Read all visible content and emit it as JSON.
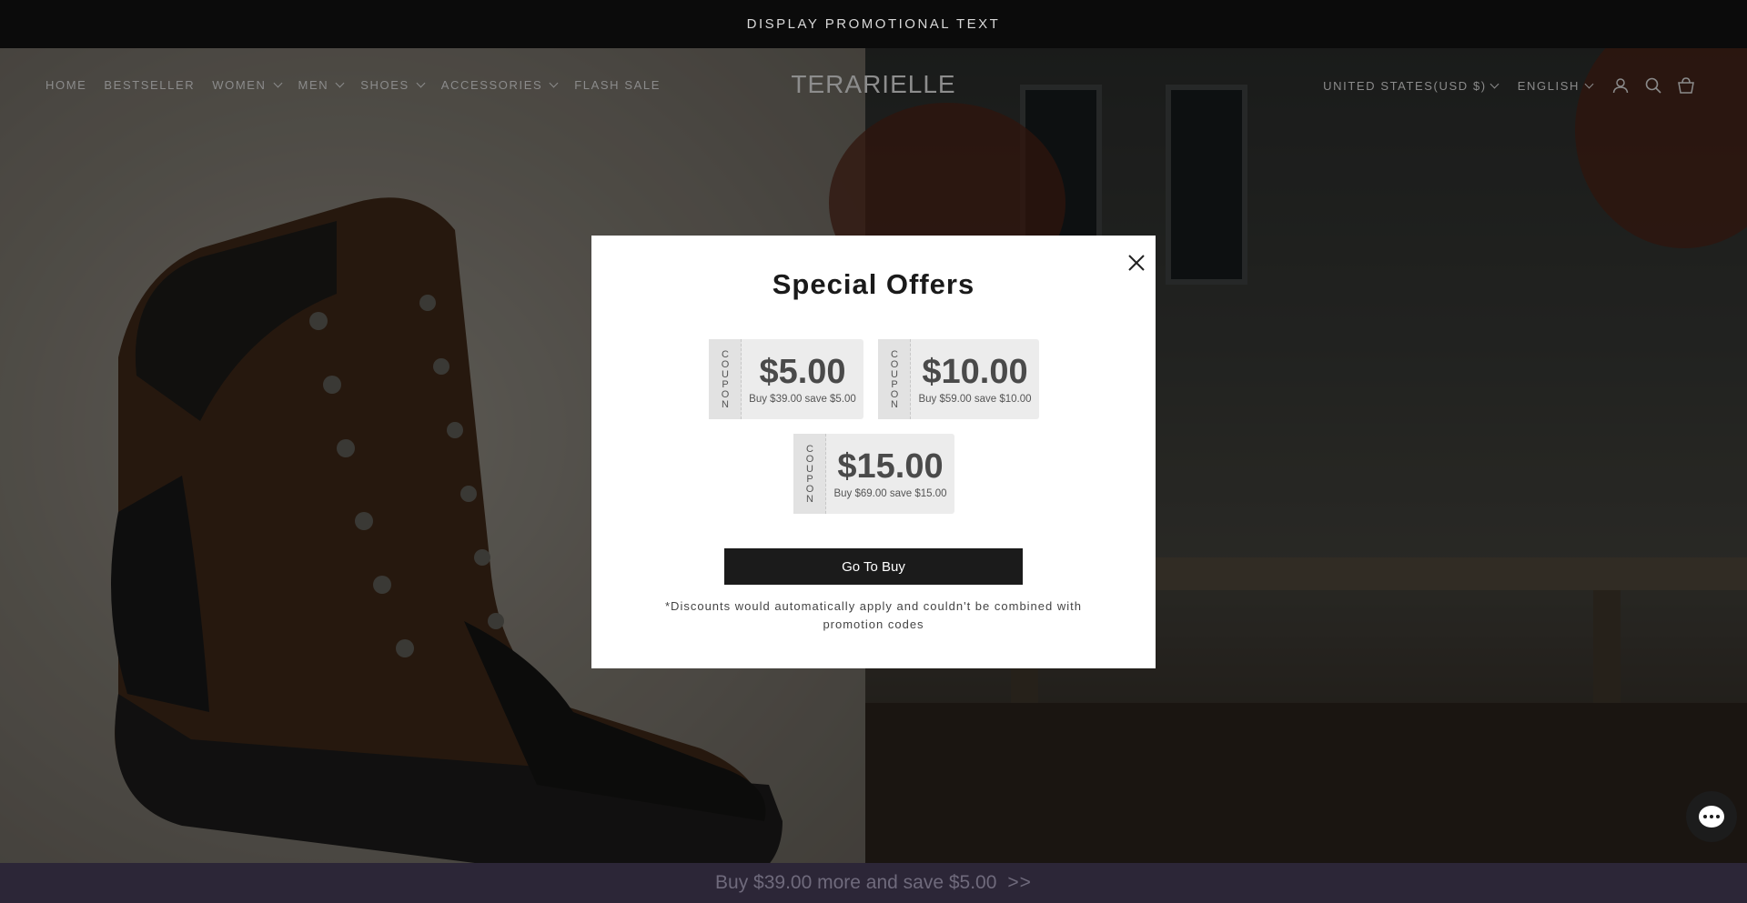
{
  "announcement": {
    "text": "DISPLAY PROMOTIONAL TEXT"
  },
  "header": {
    "logo": "TERARIELLE",
    "nav": [
      {
        "label": "HOME"
      },
      {
        "label": "BESTSELLER"
      },
      {
        "label": "WOMEN"
      },
      {
        "label": "MEN"
      },
      {
        "label": "SHOES"
      },
      {
        "label": "ACCESSORIES"
      },
      {
        "label": "FLASH SALE"
      }
    ],
    "country": "UNITED STATES(USD $)",
    "language": "ENGLISH",
    "icons": [
      "account-icon",
      "search-icon",
      "cart-icon"
    ]
  },
  "modal": {
    "title": "Special Offers",
    "coupon_word": "COUPON",
    "coupons": [
      {
        "amount": "$5.00",
        "desc": "Buy $39.00 save $5.00"
      },
      {
        "amount": "$10.00",
        "desc": "Buy $59.00 save $10.00"
      },
      {
        "amount": "$15.00",
        "desc": "Buy $69.00 save $15.00"
      }
    ],
    "button": "Go To Buy",
    "disclaimer": "*Discounts would automatically apply and couldn't be combined with promotion codes"
  },
  "promo_bar": {
    "text": "Buy $39.00 more and save $5.00",
    "arrow": ">>"
  },
  "colors": {
    "accent": "#1b1b1b",
    "promo_bg": "#2c2637",
    "overlay": "rgba(0,0,0,0.55)"
  }
}
